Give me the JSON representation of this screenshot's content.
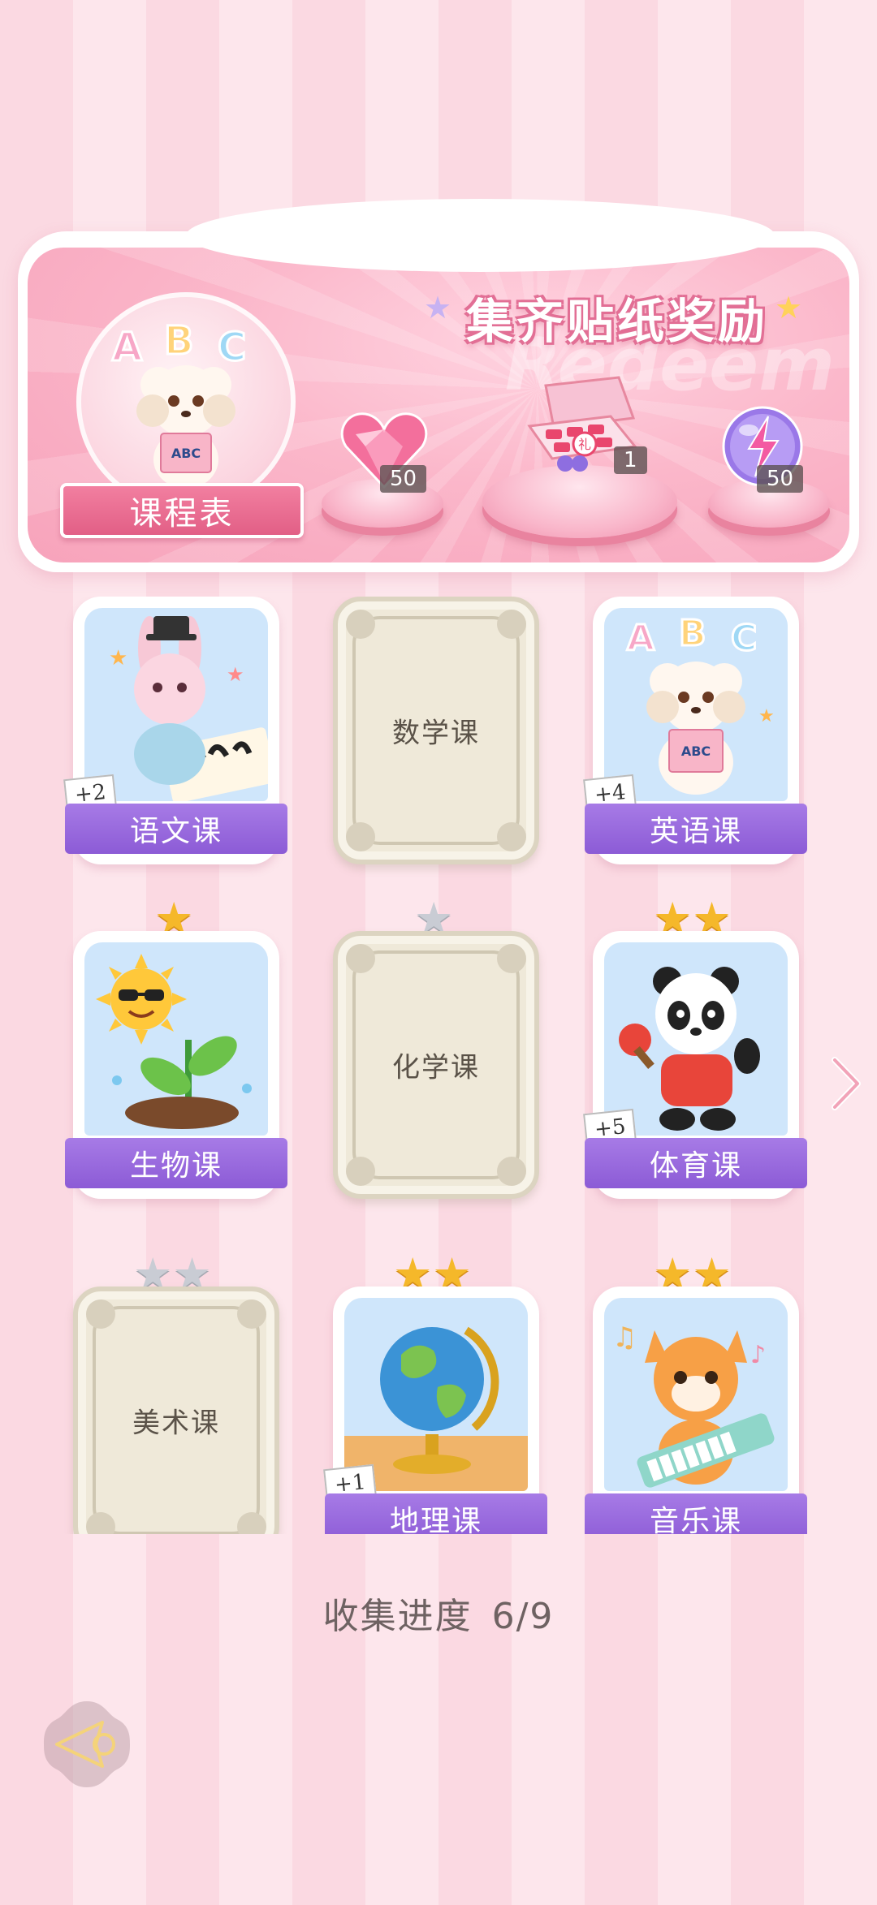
{
  "reward_banner": {
    "title": "集齐贴纸奖励",
    "watermark": "Redeem",
    "schedule_label": "课程表",
    "rewards": [
      {
        "name": "heart-gem",
        "count": "50"
      },
      {
        "name": "gift-box",
        "count": "1"
      },
      {
        "name": "energy-orb",
        "count": "50"
      }
    ]
  },
  "courses": [
    {
      "id": "chinese",
      "label": "语文课",
      "unlocked": true,
      "stars": 0,
      "bonus": "+2",
      "icon": "bunny-calligraphy"
    },
    {
      "id": "math",
      "label": "数学课",
      "unlocked": false,
      "stars": 0,
      "bonus": ""
    },
    {
      "id": "english",
      "label": "英语课",
      "unlocked": true,
      "stars": 0,
      "bonus": "+4",
      "icon": "poodle-abc"
    },
    {
      "id": "biology",
      "label": "生物课",
      "unlocked": true,
      "stars": 1,
      "star_color": "gold",
      "bonus": "",
      "icon": "sun-sprout"
    },
    {
      "id": "chemistry",
      "label": "化学课",
      "unlocked": false,
      "stars": 1,
      "star_color": "silver",
      "bonus": ""
    },
    {
      "id": "pe",
      "label": "体育课",
      "unlocked": true,
      "stars": 2,
      "star_color": "gold",
      "bonus": "+5",
      "icon": "panda-pingpong"
    },
    {
      "id": "art",
      "label": "美术课",
      "unlocked": false,
      "stars": 2,
      "star_color": "silver",
      "bonus": ""
    },
    {
      "id": "geography",
      "label": "地理课",
      "unlocked": true,
      "stars": 2,
      "star_color": "gold",
      "bonus": "+1",
      "icon": "globe"
    },
    {
      "id": "music",
      "label": "音乐课",
      "unlocked": true,
      "stars": 2,
      "star_color": "gold",
      "bonus": "",
      "icon": "cat-keyboard"
    }
  ],
  "progress": {
    "label": "收集进度",
    "value": "6/9"
  },
  "colors": {
    "accent": "#9a68de",
    "pink": "#f27fa0",
    "gold_star": "#f5b82a",
    "locked_card": "#efe9d9"
  }
}
